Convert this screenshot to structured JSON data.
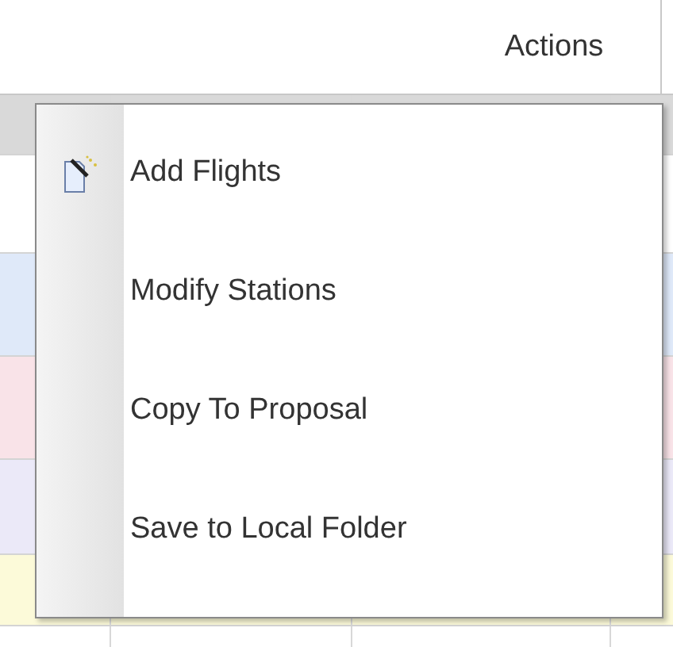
{
  "table": {
    "columns": [
      {
        "label": "Actions"
      }
    ],
    "rows": [
      {
        "color": "#d9d9d9"
      },
      {
        "color": "#ffffff"
      },
      {
        "color": "#dfe9f9"
      },
      {
        "color": "#f9e3e8"
      },
      {
        "color": "#ebe9f8"
      },
      {
        "color": "#fcfad9"
      },
      {
        "color": "#ffffff"
      }
    ]
  },
  "menu": {
    "items": [
      {
        "label": "Add Flights",
        "kind": "icon"
      },
      {
        "label": "Modify Stations",
        "kind": "plain"
      },
      {
        "label": "Copy To Proposal",
        "kind": "plain"
      },
      {
        "label": "Save to Local Folder",
        "kind": "plain"
      }
    ]
  }
}
